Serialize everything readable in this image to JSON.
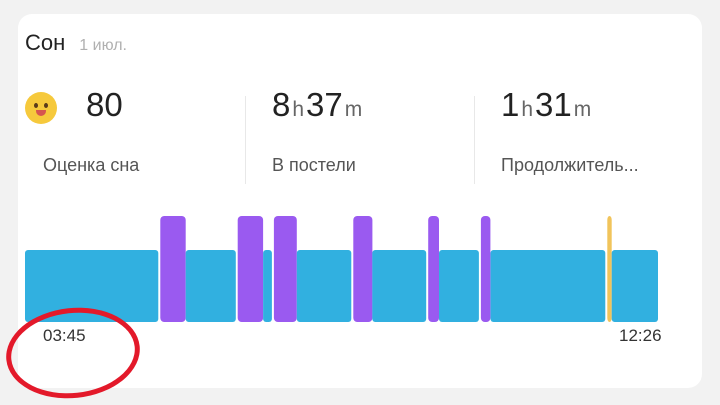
{
  "header": {
    "title": "Сон",
    "date": "1 июл."
  },
  "metrics": [
    {
      "emoji": "smiling-face-icon",
      "value": "80",
      "label": "Оценка сна"
    },
    {
      "h": "8",
      "h_unit": "h",
      "m": "37",
      "m_unit": "m",
      "label": "В постели"
    },
    {
      "h": "1",
      "h_unit": "h",
      "m": "31",
      "m_unit": "m",
      "label": "Продолжитель..."
    }
  ],
  "colors": {
    "light": "#31b0e0",
    "rem": "#9a5af0",
    "awake": "#f1c45b",
    "annotation": "#e3192a"
  },
  "chart_data": {
    "type": "timeline",
    "x_start": "03:45",
    "x_end": "12:26",
    "stages": [
      {
        "stage": "light",
        "start": 0.0,
        "end": 0.213
      },
      {
        "stage": "rem",
        "start": 0.213,
        "end": 0.253
      },
      {
        "stage": "light",
        "start": 0.253,
        "end": 0.335
      },
      {
        "stage": "rem",
        "start": 0.335,
        "end": 0.375
      },
      {
        "stage": "light",
        "start": 0.375,
        "end": 0.392
      },
      {
        "stage": "rem",
        "start": 0.392,
        "end": 0.428
      },
      {
        "stage": "light",
        "start": 0.428,
        "end": 0.517
      },
      {
        "stage": "rem",
        "start": 0.517,
        "end": 0.547
      },
      {
        "stage": "light",
        "start": 0.547,
        "end": 0.635
      },
      {
        "stage": "rem",
        "start": 0.635,
        "end": 0.652
      },
      {
        "stage": "light",
        "start": 0.652,
        "end": 0.718
      },
      {
        "stage": "rem",
        "start": 0.718,
        "end": 0.733
      },
      {
        "stage": "light",
        "start": 0.733,
        "end": 0.917
      },
      {
        "stage": "awake",
        "start": 0.917,
        "end": 0.924
      },
      {
        "stage": "light",
        "start": 0.924,
        "end": 1.0
      }
    ]
  }
}
